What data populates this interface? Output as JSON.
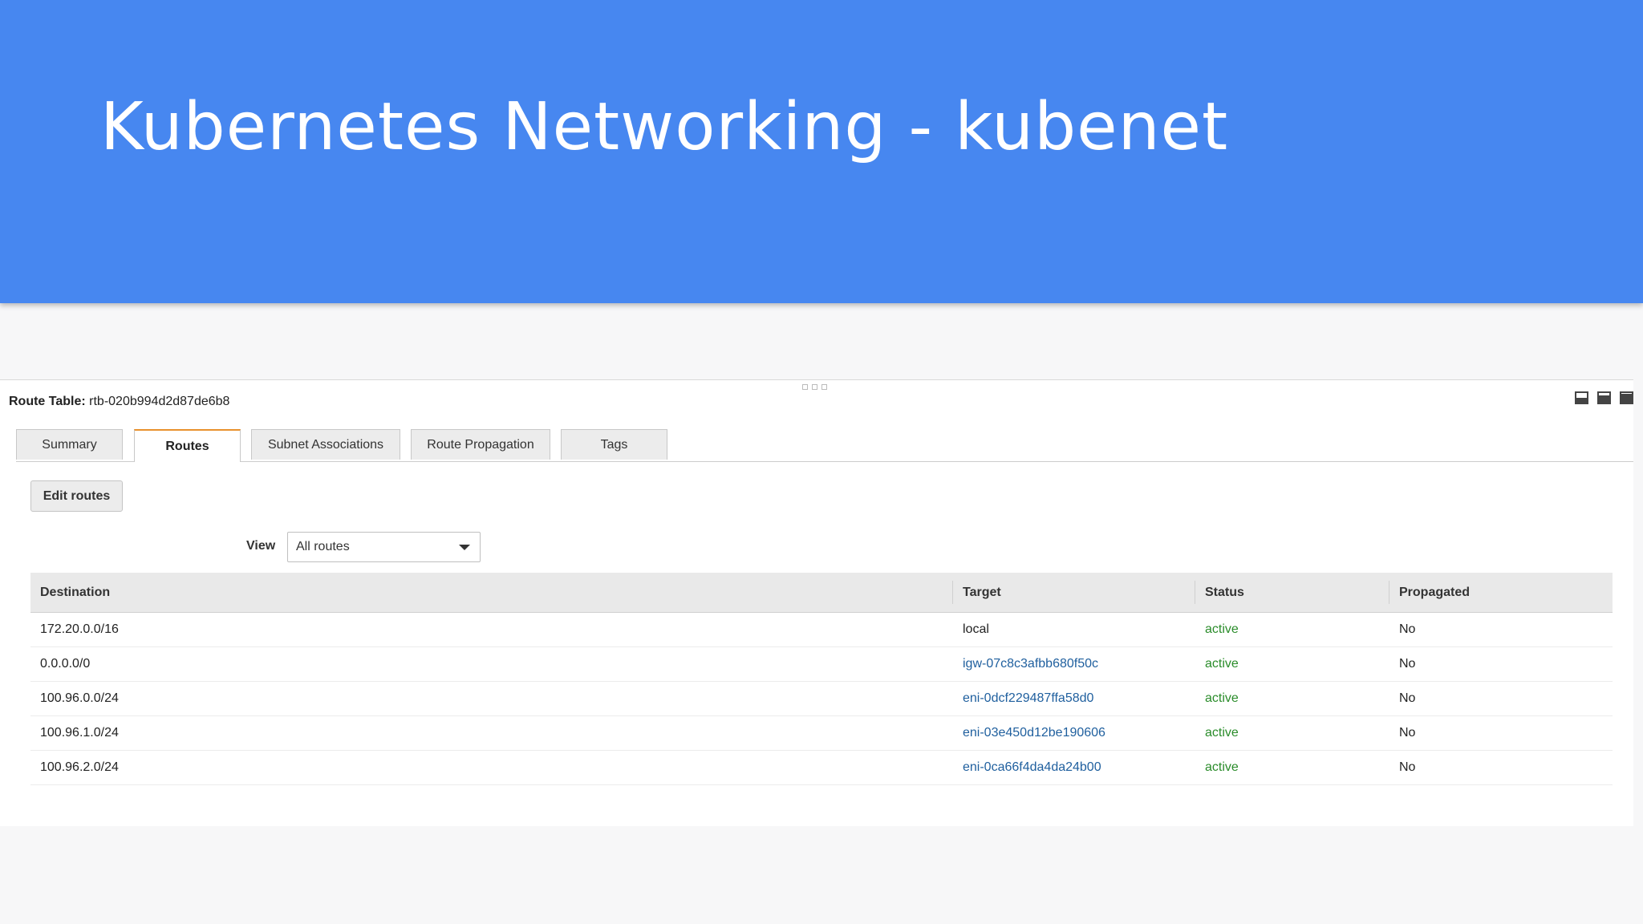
{
  "slide": {
    "title": "Kubernetes Networking - kubenet"
  },
  "colors": {
    "banner": "#4787f0",
    "active_tab_accent": "#e8912d",
    "link": "#1f5f9e",
    "status_active": "#2a8c2a"
  },
  "route_table": {
    "label": "Route Table:",
    "id": "rtb-020b994d2d87de6b8"
  },
  "tabs": [
    {
      "label": "Summary",
      "active": false
    },
    {
      "label": "Routes",
      "active": true
    },
    {
      "label": "Subnet Associations",
      "active": false
    },
    {
      "label": "Route Propagation",
      "active": false
    },
    {
      "label": "Tags",
      "active": false
    }
  ],
  "toolbar": {
    "edit_routes_label": "Edit routes",
    "view_label": "View",
    "view_value": "All routes"
  },
  "table": {
    "columns": [
      "Destination",
      "Target",
      "Status",
      "Propagated"
    ],
    "rows": [
      {
        "destination": "172.20.0.0/16",
        "target": "local",
        "target_is_link": false,
        "status": "active",
        "propagated": "No"
      },
      {
        "destination": "0.0.0.0/0",
        "target": "igw-07c8c3afbb680f50c",
        "target_is_link": true,
        "status": "active",
        "propagated": "No"
      },
      {
        "destination": "100.96.0.0/24",
        "target": "eni-0dcf229487ffa58d0",
        "target_is_link": true,
        "status": "active",
        "propagated": "No"
      },
      {
        "destination": "100.96.1.0/24",
        "target": "eni-03e450d12be190606",
        "target_is_link": true,
        "status": "active",
        "propagated": "No"
      },
      {
        "destination": "100.96.2.0/24",
        "target": "eni-0ca66f4da4da24b00",
        "target_is_link": true,
        "status": "active",
        "propagated": "No"
      }
    ]
  }
}
